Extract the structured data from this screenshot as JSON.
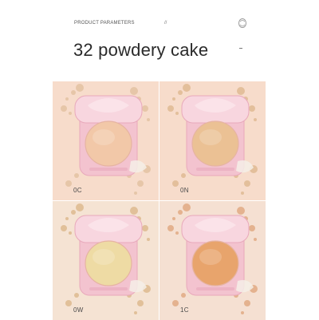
{
  "header": {
    "label": "PRODUCT PARAMETERS",
    "slash": "//"
  },
  "title": "32 powdery cake",
  "shades": [
    {
      "label": "0C",
      "powder": "#f2c8a8",
      "bg": "#f7dccb",
      "crumble": "#d8b48c"
    },
    {
      "label": "0N",
      "powder": "#ebc194",
      "bg": "#f7dccb",
      "crumble": "#d3a874"
    },
    {
      "label": "0W",
      "powder": "#eedba4",
      "bg": "#f5e3d3",
      "crumble": "#cfa469"
    },
    {
      "label": "1C",
      "powder": "#e8a46c",
      "bg": "#f5e0d2",
      "crumble": "#d58d57"
    }
  ],
  "colors": {
    "case_pink": "#f3c3cf",
    "case_rim": "#e8a9bb"
  }
}
